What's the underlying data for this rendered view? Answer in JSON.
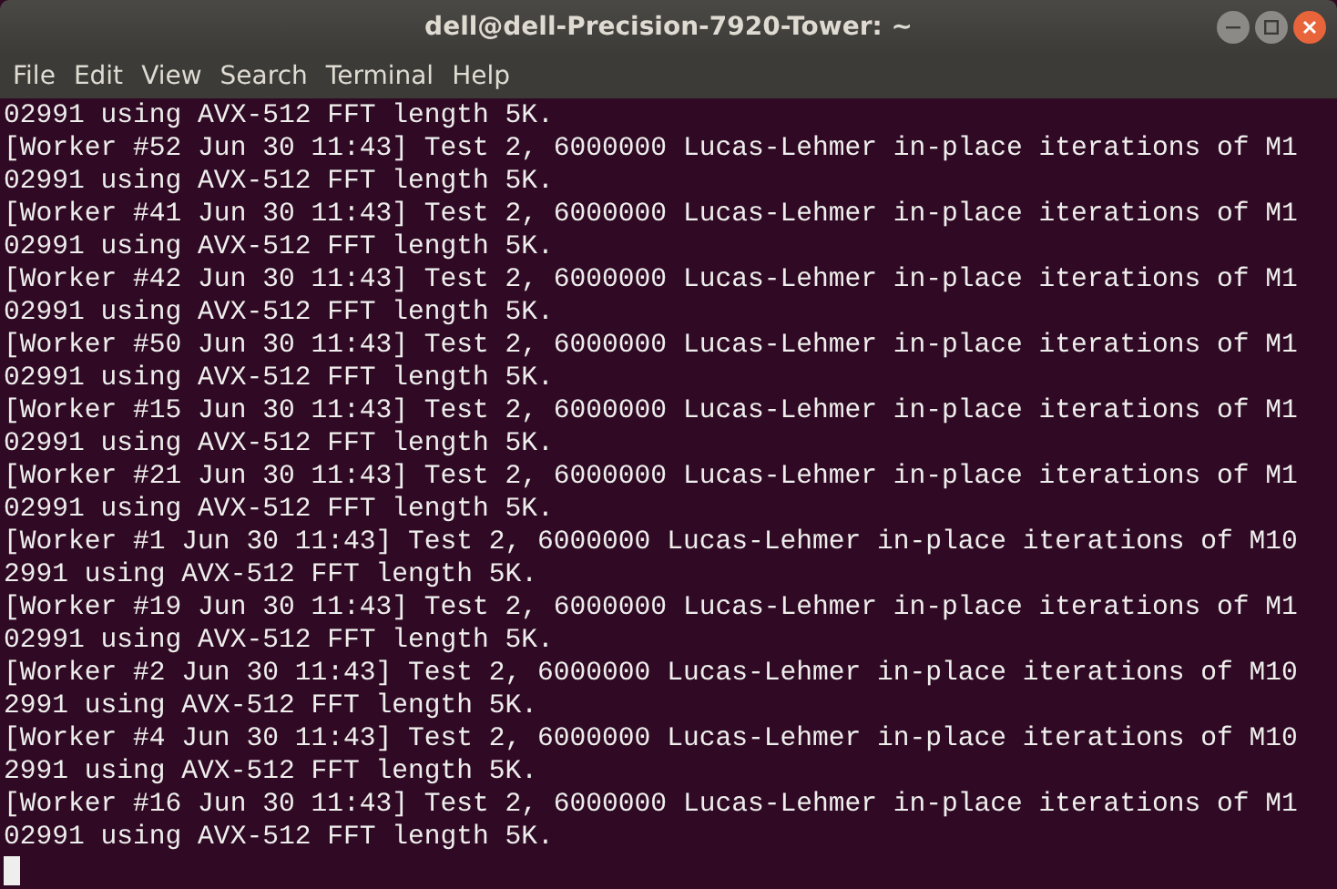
{
  "window": {
    "title": "dell@dell-Precision-7920-Tower: ~"
  },
  "menu": [
    "File",
    "Edit",
    "View",
    "Search",
    "Terminal",
    "Help"
  ],
  "terminal": {
    "lines": [
      "02991 using AVX-512 FFT length 5K.",
      "[Worker #52 Jun 30 11:43] Test 2, 6000000 Lucas-Lehmer in-place iterations of M1",
      "02991 using AVX-512 FFT length 5K.",
      "[Worker #41 Jun 30 11:43] Test 2, 6000000 Lucas-Lehmer in-place iterations of M1",
      "02991 using AVX-512 FFT length 5K.",
      "[Worker #42 Jun 30 11:43] Test 2, 6000000 Lucas-Lehmer in-place iterations of M1",
      "02991 using AVX-512 FFT length 5K.",
      "[Worker #50 Jun 30 11:43] Test 2, 6000000 Lucas-Lehmer in-place iterations of M1",
      "02991 using AVX-512 FFT length 5K.",
      "[Worker #15 Jun 30 11:43] Test 2, 6000000 Lucas-Lehmer in-place iterations of M1",
      "02991 using AVX-512 FFT length 5K.",
      "[Worker #21 Jun 30 11:43] Test 2, 6000000 Lucas-Lehmer in-place iterations of M1",
      "02991 using AVX-512 FFT length 5K.",
      "[Worker #1 Jun 30 11:43] Test 2, 6000000 Lucas-Lehmer in-place iterations of M10",
      "2991 using AVX-512 FFT length 5K.",
      "[Worker #19 Jun 30 11:43] Test 2, 6000000 Lucas-Lehmer in-place iterations of M1",
      "02991 using AVX-512 FFT length 5K.",
      "[Worker #2 Jun 30 11:43] Test 2, 6000000 Lucas-Lehmer in-place iterations of M10",
      "2991 using AVX-512 FFT length 5K.",
      "[Worker #4 Jun 30 11:43] Test 2, 6000000 Lucas-Lehmer in-place iterations of M10",
      "2991 using AVX-512 FFT length 5K.",
      "[Worker #16 Jun 30 11:43] Test 2, 6000000 Lucas-Lehmer in-place iterations of M1",
      "02991 using AVX-512 FFT length 5K."
    ]
  }
}
